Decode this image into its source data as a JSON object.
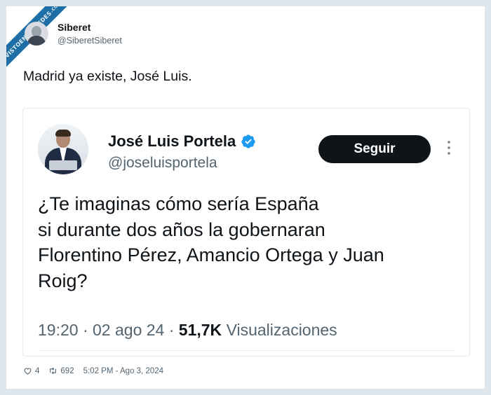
{
  "watermark": {
    "text": "VISTOENLASREDES",
    "suffix": ".COM"
  },
  "tweet": {
    "author_name": "Siberet",
    "author_handle": "@SiberetSiberet",
    "text": "Madrid ya existe, José Luis.",
    "likes": "4",
    "retweets": "692",
    "timestamp": "5:02 PM - Ago 3, 2024"
  },
  "quoted": {
    "author_name": "José Luis Portela",
    "author_handle": "@joseluisportela",
    "follow_label": "Seguir",
    "text_lines": [
      "¿Te imaginas cómo sería España",
      "si durante dos años la gobernaran",
      "Florentino Pérez, Amancio Ortega y Juan",
      "Roig?"
    ],
    "time": "19:20",
    "date": "02 ago 24",
    "views_count": "51,7K",
    "views_label": "Visualizaciones",
    "verified_color": "#1d9bf0"
  },
  "icons": {
    "like": "heart-icon",
    "retweet": "retweet-icon",
    "verified": "verified-badge-icon",
    "more": "more-options-icon"
  }
}
